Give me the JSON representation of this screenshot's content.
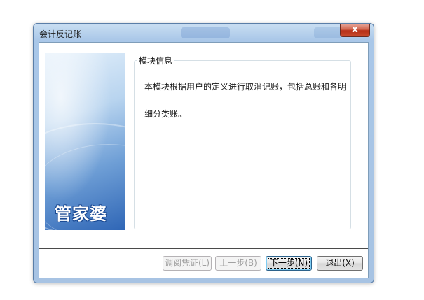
{
  "window": {
    "title": "会计反记账",
    "close_label": "x"
  },
  "banner": {
    "logo_text": "管家婆"
  },
  "group": {
    "title": "模块信息",
    "text": "本模块根据用户的定义进行取消记账，包括总账和各明细分类账。"
  },
  "buttons": {
    "voucher": "调阅凭证(L)",
    "prev": "上一步(B)",
    "next": "下一步(N)",
    "exit": "退出(X)"
  }
}
